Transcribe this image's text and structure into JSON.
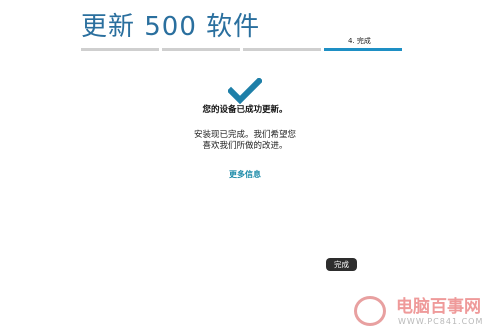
{
  "header": {
    "title": "更新 500 软件"
  },
  "progress": {
    "current_step_label": "4. 完成",
    "total_steps": 4,
    "current_step": 4
  },
  "main": {
    "check_icon": "checkmark-icon",
    "headline": "您的设备已成功更新。",
    "description": "安装现已完成。我们希望您喜欢我们所做的改进。",
    "more_info_link": "更多信息"
  },
  "footer": {
    "done_button": "完成"
  },
  "watermark": {
    "brand": "电脑百事网",
    "url": "WWW.PC841.COM"
  },
  "colors": {
    "title": "#2a6f9e",
    "accent": "#1e8fc4",
    "check": "#1e7fa8",
    "link": "#1a8aa8",
    "button_bg": "#2d2d2d"
  }
}
